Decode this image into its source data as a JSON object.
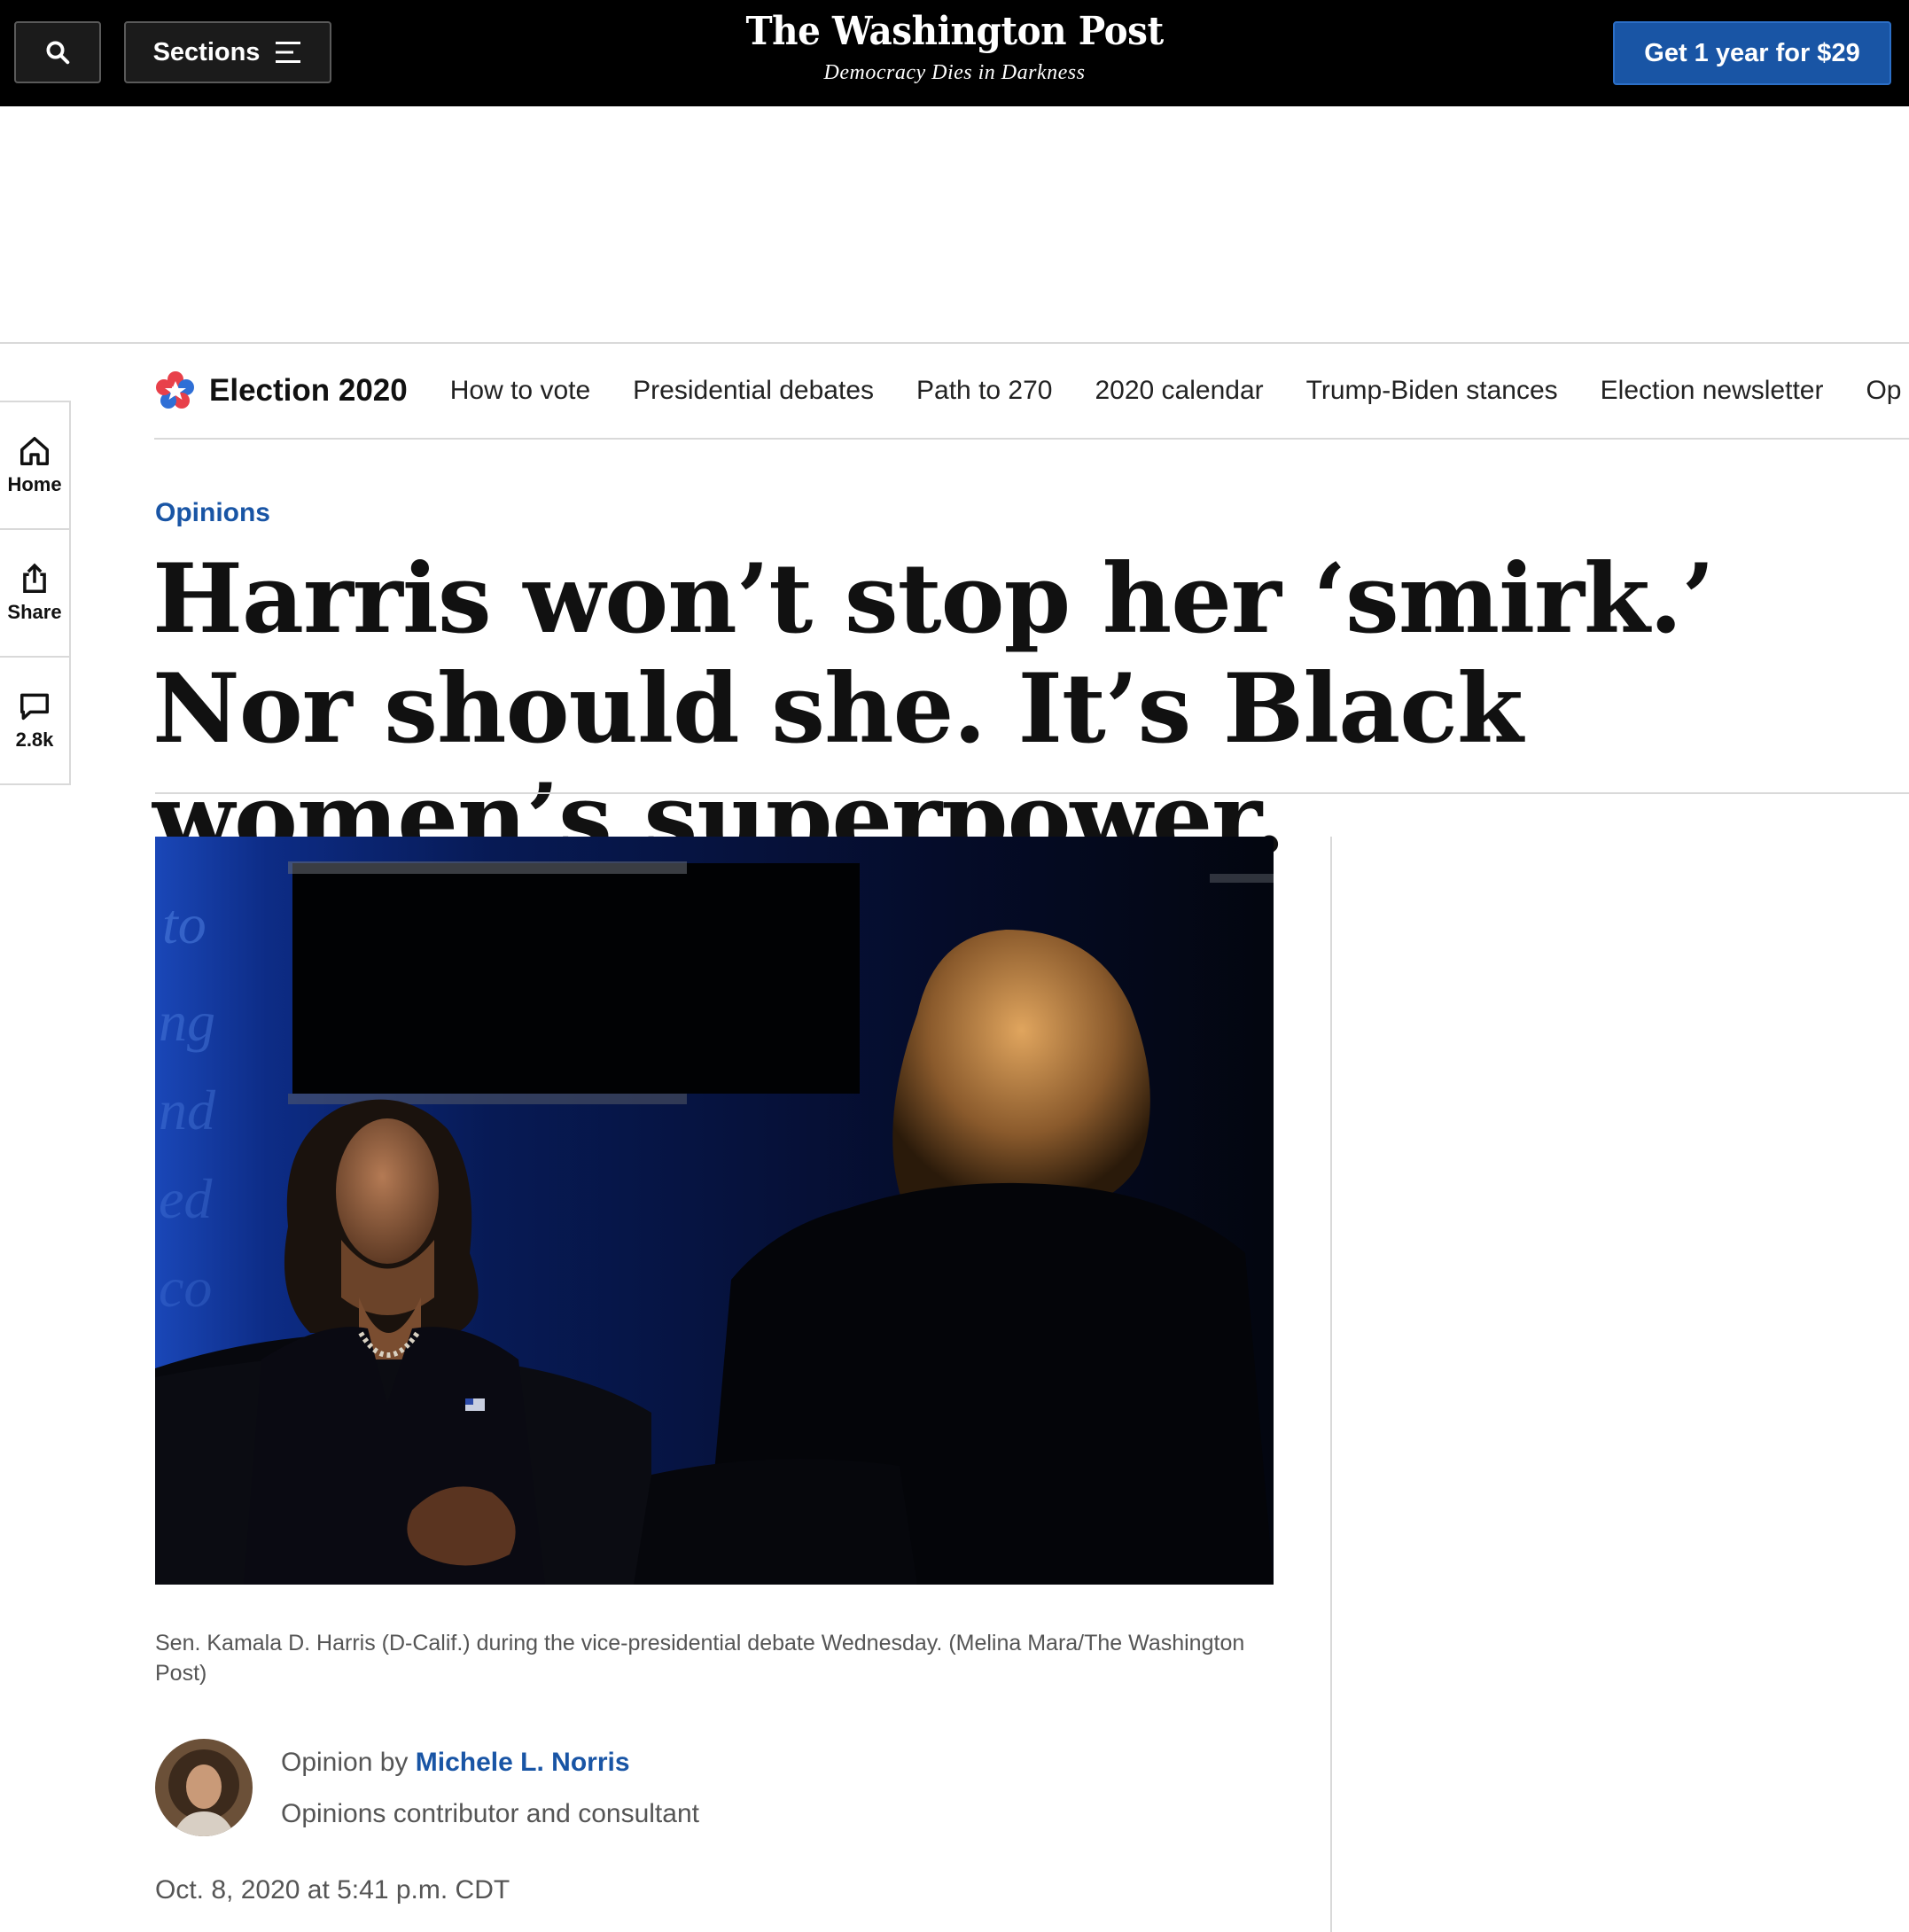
{
  "topbar": {
    "sections_label": "Sections",
    "logo": "The Washington Post",
    "tagline": "Democracy Dies in Darkness",
    "subscribe_label": "Get 1 year for $29"
  },
  "election_nav": {
    "title": "Election 2020",
    "links": [
      "How to vote",
      "Presidential debates",
      "Path to 270",
      "2020 calendar",
      "Trump-Biden stances",
      "Election newsletter",
      "Op"
    ]
  },
  "rail": {
    "home_label": "Home",
    "share_label": "Share",
    "comments_count": "2.8k"
  },
  "article": {
    "kicker": "Opinions",
    "headline": "Harris won’t stop her ‘smirk.’ Nor should she. It’s Black women’s superpower.",
    "caption": "Sen. Kamala D. Harris (D-Calif.) during the vice-presidential debate Wednesday. (Melina Mara/The Washington Post)",
    "byline_prefix": "Opinion by",
    "author": "Michele L. Norris",
    "author_role": "Opinions contributor and consultant",
    "date": "Oct. 8, 2020 at 5:41 p.m. CDT"
  },
  "colors": {
    "brand_blue": "#1955a5",
    "topbar_bg": "#000000",
    "rule": "#d9d9d9"
  }
}
